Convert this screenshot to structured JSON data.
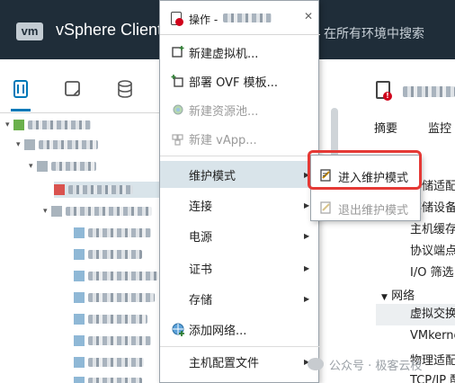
{
  "header": {
    "logo_text": "vm",
    "app_title": "vSphere Client",
    "search_hint": "在所有环境中搜索"
  },
  "nav": {
    "icons": [
      "hosts-clusters-icon",
      "vms-templates-icon",
      "storage-icon"
    ]
  },
  "right_panel": {
    "tabs": [
      "摘要",
      "监控"
    ],
    "items": [
      {
        "label": "存储适配",
        "type": "item"
      },
      {
        "label": "存储设备",
        "type": "item"
      },
      {
        "label": "主机缓存",
        "type": "item"
      },
      {
        "label": "协议端点",
        "type": "item"
      },
      {
        "label": "I/O 筛选",
        "type": "item"
      },
      {
        "label": "网络",
        "type": "section"
      },
      {
        "label": "虚拟交换",
        "type": "item"
      },
      {
        "label": "VMkerne",
        "type": "item"
      },
      {
        "label": "物理适配",
        "type": "item"
      },
      {
        "label": "TCP/IP 配",
        "type": "item"
      }
    ]
  },
  "context_menu": {
    "header_label": "操作 -",
    "items": {
      "new_vm": "新建虚拟机...",
      "deploy_ovf": "部署 OVF 模板...",
      "new_pool": "新建资源池...",
      "new_vapp": "新建 vApp...",
      "maintenance": "维护模式",
      "connection": "连接",
      "power": "电源",
      "certificates": "证书",
      "storage": "存储",
      "add_network": "添加网络...",
      "host_profiles": "主机配置文件"
    }
  },
  "submenu": {
    "enter_maintenance": "进入维护模式",
    "exit_maintenance": "退出维护模式"
  },
  "watermark": "公众号 · 极客云枝",
  "colors": {
    "header_bg": "#1f2d39",
    "accent": "#0079b8",
    "highlight_box": "#e53935",
    "alert": "#d0021b"
  }
}
